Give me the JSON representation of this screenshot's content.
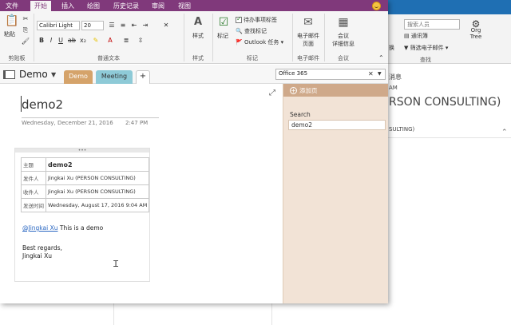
{
  "outlook_bg": {
    "search_placeholder": "搜索人员",
    "address_book": "通讯簿",
    "filter_mail": "筛选电子邮件",
    "find_group": "查找",
    "org_tree": "Org Tree",
    "change_label": "换",
    "text_am": "AM",
    "text_message": "消息",
    "person_big": "RSON CONSULTING)",
    "person_small": "SULTING)"
  },
  "menu": {
    "tabs": [
      "文件",
      "开始",
      "插入",
      "绘图",
      "历史记录",
      "审阅",
      "视图"
    ],
    "active_tab": "开始"
  },
  "ribbon": {
    "paste": "粘贴",
    "clipboard_group": "剪贴板",
    "font_name": "Calibri Light",
    "font_size": "20",
    "basic_text_group": "普通文本",
    "styles": "样式",
    "styles_group": "样式",
    "tag": "标记",
    "todo_tag": "待办事项标签",
    "find_tags": "查找标记",
    "outlook_tasks": "Outlook 任务",
    "tags_group": "标记",
    "email_page_line1": "电子邮件",
    "email_page_line2": "页面",
    "email_group": "电子邮件",
    "meeting_line1": "会议",
    "meeting_line2": "详细信息",
    "meeting_group": "会议"
  },
  "notebook": {
    "name": "Demo",
    "sections": [
      "Demo",
      "Meeting"
    ],
    "add_section": "+",
    "search_value": "Office 365"
  },
  "page": {
    "title": "demo2",
    "date": "Wednesday, December 21, 2016",
    "time": "2:47 PM",
    "mail": {
      "rows": [
        {
          "label": "主题",
          "value": "demo2"
        },
        {
          "label": "发件人",
          "value": "Jingkai Xu (PERSON CONSULTING)"
        },
        {
          "label": "收件人",
          "value": "Jingkai Xu (PERSON CONSULTING)"
        },
        {
          "label": "发送时间",
          "value": "Wednesday, August 17, 2016 9:04 AM"
        }
      ],
      "mention": "@Jingkai Xu",
      "body": "This is a demo",
      "regards": "Best regards,",
      "signature": "Jingkai Xu"
    }
  },
  "pages_pane": {
    "add_page": "添加页",
    "search_heading": "Search",
    "items": [
      "demo2"
    ]
  },
  "colors": {
    "onenote_purple": "#80397b",
    "section_demo": "#d5a36a",
    "section_meeting": "#8ecad7",
    "pages_pane_bg": "#f2e3d6",
    "outlook_blue": "#1f6fb3"
  }
}
